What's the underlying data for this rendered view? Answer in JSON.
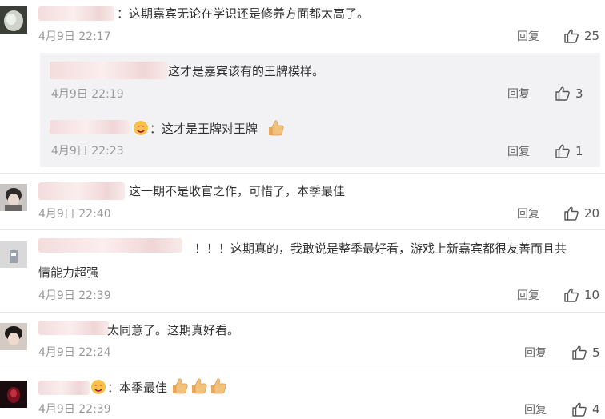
{
  "colors": {
    "text": "#333333",
    "time": "#999999",
    "reply_bg": "#f2f2f5",
    "divider": "#e8e8e8",
    "thumb_emoji": "#f2c27a"
  },
  "comments": [
    {
      "text": "：这期嘉宾无论在学识还是修养方面都太高了。",
      "time": "4月9日 22:17",
      "reply": "回复",
      "likes": "25"
    },
    {
      "text": "这一期不是收官之作，可惜了，本季最佳",
      "time": "4月9日 22:40",
      "reply": "回复",
      "likes": "20"
    },
    {
      "text_line1": "！！！这期真的，我敢说是整季最好看，游戏上新嘉宾都很友善而且共",
      "text_line2": "情能力超强",
      "time": "4月9日 22:39",
      "reply": "回复",
      "likes": "10"
    },
    {
      "text": "太同意了。这期真好看。",
      "time": "4月9日 22:24",
      "reply": "回复",
      "likes": "5"
    },
    {
      "text": "：本季最佳",
      "time": "4月9日 22:39",
      "reply": "回复",
      "likes": "4"
    }
  ],
  "replies": [
    {
      "text": "这才是嘉宾该有的王牌模样。",
      "time": "4月9日 22:19",
      "reply": "回复",
      "likes": "3"
    },
    {
      "text": "：这才是王牌对王牌",
      "time": "4月9日 22:23",
      "reply": "回复",
      "likes": "1"
    }
  ],
  "icons": {
    "like": "thumbs-up-outline-icon",
    "thumb_emoji": "thumbs-up-emoji-icon",
    "face_emoji": "heart-eyes-emoji-icon"
  }
}
